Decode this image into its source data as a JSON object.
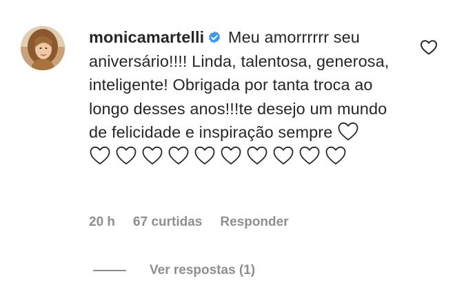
{
  "comment": {
    "username": "monicamartelli",
    "verified": true,
    "text": "Meu amorrrrrr seu aniversário!!!! Linda, talentosa, generosa, inteligente! Obrigada por tanta troca ao longo desses anos!!!te desejo um mundo de felicidade e inspiração sempre",
    "trailing_hearts_count": 11,
    "trailing_heart_icon": "white-heart-emoji",
    "like_icon": "heart-outline-icon",
    "avatar_icon": "profile-avatar"
  },
  "meta": {
    "time": "20 h",
    "likes": "67 curtidas",
    "reply": "Responder"
  },
  "replies": {
    "label": "Ver respostas (1)"
  },
  "colors": {
    "text": "#262626",
    "secondary": "#8e8e8e",
    "verified": "#3897f0"
  }
}
